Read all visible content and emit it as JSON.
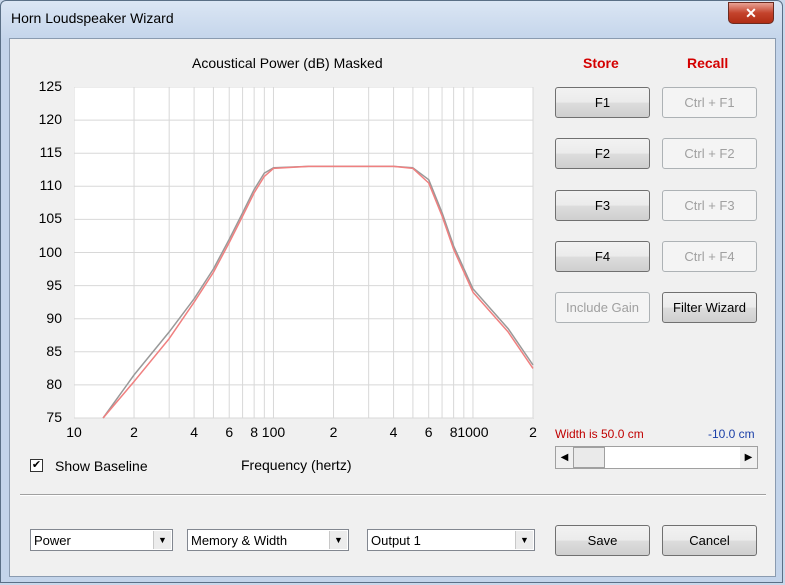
{
  "window": {
    "title": "Horn Loudspeaker Wizard",
    "close_glyph": "✕"
  },
  "chart_title": "Acoustical Power (dB)   Masked",
  "store_label": "Store",
  "recall_label": "Recall",
  "store_buttons": [
    "F1",
    "F2",
    "F3",
    "F4"
  ],
  "recall_buttons": [
    "Ctrl + F1",
    "Ctrl + F2",
    "Ctrl + F3",
    "Ctrl + F4"
  ],
  "include_gain_label": "Include Gain",
  "filter_wizard_label": "Filter Wizard",
  "width_text": "Width is 50.0 cm",
  "offset_text": "-10.0 cm",
  "show_baseline_label": "Show Baseline",
  "show_baseline_checked": true,
  "xlabel": "Frequency (hertz)",
  "dropdowns": [
    "Power",
    "Memory & Width",
    "Output 1"
  ],
  "save_label": "Save",
  "cancel_label": "Cancel",
  "chart_data": {
    "type": "line",
    "title": "Acoustical Power (dB)   Masked",
    "xlabel": "Frequency (hertz)",
    "ylabel": "",
    "x_scale": "log",
    "xlim": [
      10,
      2000
    ],
    "ylim": [
      75,
      125
    ],
    "y_ticks": [
      75,
      80,
      85,
      90,
      95,
      100,
      105,
      110,
      115,
      120,
      125
    ],
    "x_tick_labels": [
      "10",
      "2",
      "4",
      "6",
      "8",
      "100",
      "2",
      "4",
      "6",
      "8",
      "1000",
      "2"
    ],
    "grid": true,
    "series": [
      {
        "color": "#999999",
        "x": [
          14,
          20,
          30,
          40,
          50,
          60,
          70,
          80,
          90,
          100,
          150,
          200,
          300,
          400,
          500,
          600,
          700,
          800,
          1000,
          1500,
          2000
        ],
        "y": [
          75,
          81.5,
          88,
          93,
          97.5,
          102,
          106,
          109.5,
          112,
          112.8,
          113,
          113,
          113,
          113,
          112.8,
          111,
          106,
          101,
          94.5,
          88.5,
          83
        ]
      },
      {
        "color": "#f08080",
        "x": [
          14,
          20,
          30,
          40,
          50,
          60,
          70,
          80,
          90,
          100,
          150,
          200,
          300,
          400,
          500,
          600,
          700,
          800,
          1000,
          1500,
          2000
        ],
        "y": [
          74.5,
          80.5,
          87,
          92.5,
          97,
          101.5,
          105.5,
          109,
          111.5,
          112.7,
          113,
          113,
          113,
          113,
          112.7,
          110.5,
          105.5,
          100.5,
          94,
          88,
          82.5
        ]
      }
    ]
  }
}
